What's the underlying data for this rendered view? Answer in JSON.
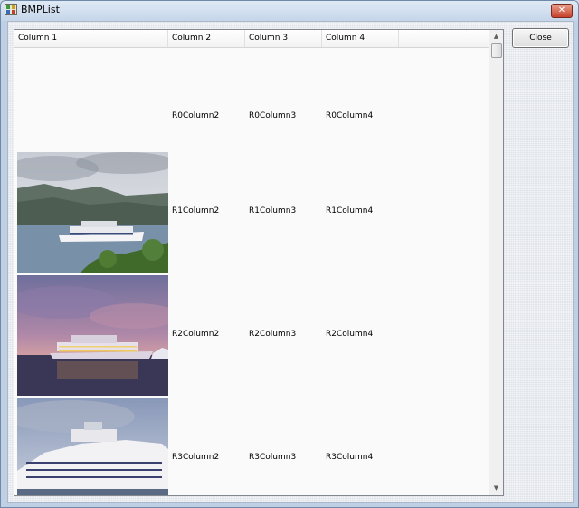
{
  "window": {
    "title": "BMPList",
    "app_icon": "list-app-icon",
    "close_icon": "close-icon"
  },
  "listview": {
    "columns": [
      "Column 1",
      "Column 2",
      "Column 3",
      "Column 4"
    ],
    "rows": [
      {
        "image": "none",
        "col2": "R0Column2",
        "col3": "R0Column3",
        "col4": "R0Column4"
      },
      {
        "image": "cruise-ship-photo-day",
        "col2": "R1Column2",
        "col3": "R1Column3",
        "col4": "R1Column4"
      },
      {
        "image": "cruise-ship-photo-sunset",
        "col2": "R2Column2",
        "col3": "R2Column3",
        "col4": "R2Column4"
      },
      {
        "image": "cruise-ship-photo-closeup",
        "col2": "R3Column2",
        "col3": "R3Column3",
        "col4": "R3Column4"
      }
    ]
  },
  "close_button": {
    "label": "Close"
  },
  "colors": {
    "window_frame": "#6f8aa8",
    "titlebar": "#c5d6ea",
    "list_background": "#fafafa",
    "close_x": "#c7412a"
  }
}
